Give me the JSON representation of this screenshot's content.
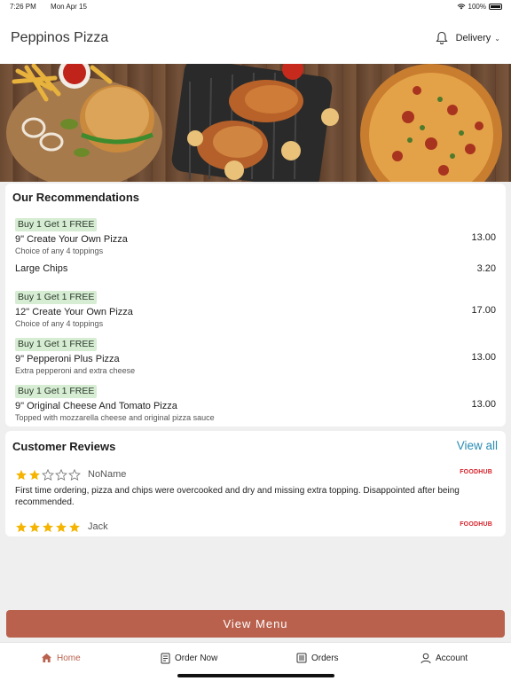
{
  "status_bar": {
    "time": "7:26 PM",
    "date": "Mon Apr 15",
    "battery": "100%"
  },
  "header": {
    "title": "Peppinos Pizza",
    "delivery_label": "Delivery"
  },
  "recommendations": {
    "title": "Our Recommendations",
    "items": [
      {
        "badge": "Buy 1 Get 1 FREE",
        "name": "9\" Create Your Own Pizza",
        "desc": "Choice of any 4 toppings",
        "price": "13.00"
      },
      {
        "badge": "",
        "name": "Large Chips",
        "desc": "",
        "price": "3.20"
      },
      {
        "badge": "Buy 1 Get 1 FREE",
        "name": "12\" Create Your Own Pizza",
        "desc": "Choice of any 4 toppings",
        "price": "17.00"
      },
      {
        "badge": "Buy 1 Get 1 FREE",
        "name": "9\" Pepperoni Plus Pizza",
        "desc": "Extra pepperoni and extra cheese",
        "price": "13.00"
      },
      {
        "badge": "Buy 1 Get 1 FREE",
        "name": "9\" Original Cheese And Tomato Pizza",
        "desc": "Topped with mozzarella cheese and original pizza sauce",
        "price": "13.00"
      }
    ]
  },
  "reviews": {
    "title": "Customer Reviews",
    "view_all": "View all",
    "items": [
      {
        "rating": 2,
        "max_rating": 5,
        "name": "NoName",
        "source": "FOODHUB",
        "text": "First time ordering, pizza and chips were overcooked and dry and missing extra topping. Disappointed after being recommended."
      },
      {
        "rating": 5,
        "max_rating": 5,
        "name": "Jack",
        "source": "FOODHUB",
        "text": ""
      }
    ]
  },
  "view_menu_label": "View Menu",
  "tabs": [
    {
      "label": "Home",
      "icon": "home-icon",
      "active": true
    },
    {
      "label": "Order Now",
      "icon": "order-icon",
      "active": false
    },
    {
      "label": "Orders",
      "icon": "orders-list-icon",
      "active": false
    },
    {
      "label": "Account",
      "icon": "account-icon",
      "active": false
    }
  ],
  "colors": {
    "accent": "#b9614d",
    "link": "#2a8cb3",
    "badge_bg": "#d6ecd3",
    "star": "#f4b400"
  }
}
